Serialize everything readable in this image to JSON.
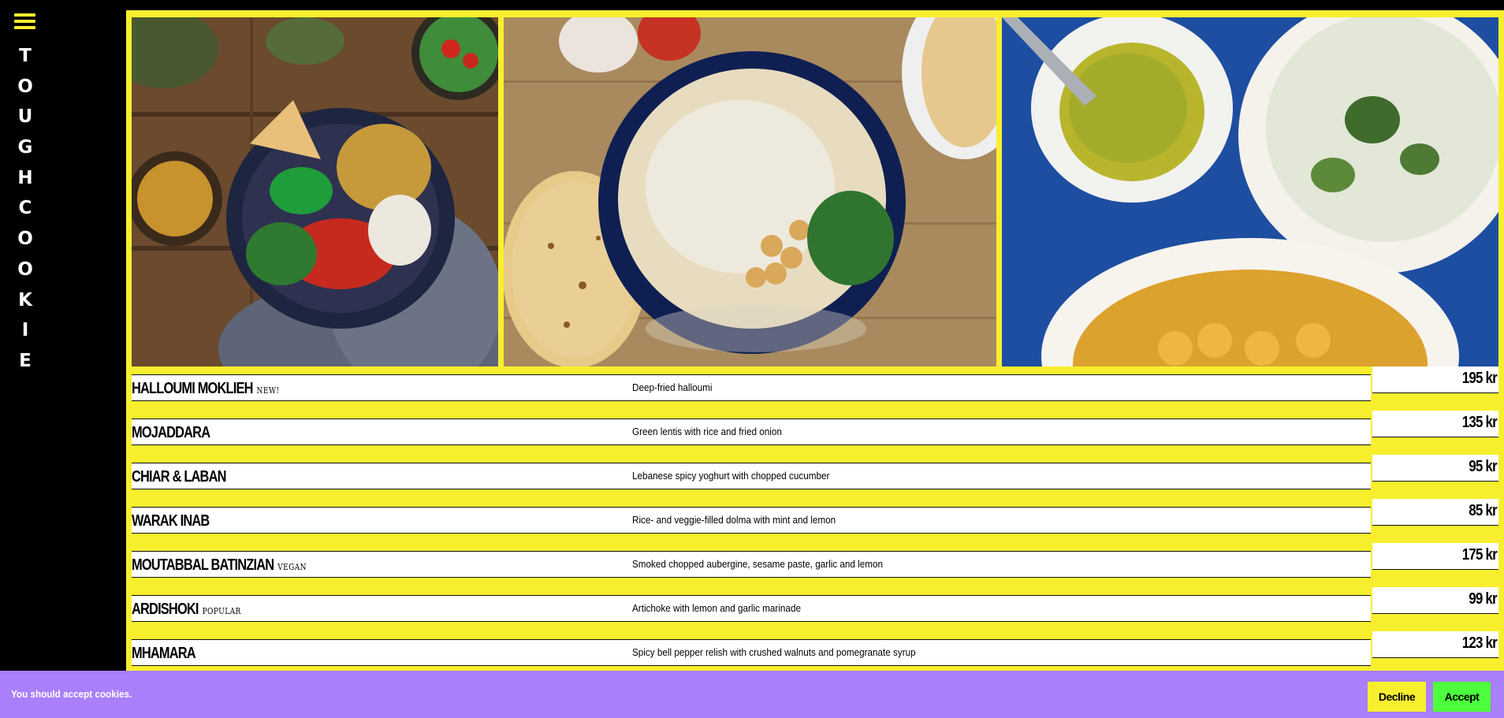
{
  "sidebar": {
    "menu_icon": "hamburger-menu-icon",
    "logo_letters": [
      "T",
      "O",
      "U",
      "G",
      "H",
      "C",
      "O",
      "O",
      "K",
      "I",
      "E"
    ]
  },
  "colors": {
    "accent_yellow": "#f7ef2e",
    "cookie_bar_purple": "#a97ffb",
    "accept_green": "#4dff3c",
    "sidebar_black": "#000000"
  },
  "menu": {
    "items": [
      {
        "name": "HALLOUMI MOKLIEH",
        "tag": "NEW!",
        "description": "Deep-fried halloumi",
        "price": "195 kr"
      },
      {
        "name": "MOJADDARA",
        "tag": "",
        "description": "Green lentis with rice and fried onion",
        "price": "135 kr"
      },
      {
        "name": "CHIAR & LABAN",
        "tag": "",
        "description": "Lebanese spicy yoghurt with chopped cucumber",
        "price": "95 kr"
      },
      {
        "name": "WARAK INAB",
        "tag": "",
        "description": "Rice- and veggie-filled dolma with mint and lemon",
        "price": "85 kr"
      },
      {
        "name": "MOUTABBAL BATINZIAN",
        "tag": "VEGAN",
        "description": "Smoked chopped aubergine, sesame paste, garlic and lemon",
        "price": "175 kr"
      },
      {
        "name": "ARDISHOKI",
        "tag": "POPULAR",
        "description": "Artichoke with lemon and garlic marinade",
        "price": "99 kr"
      },
      {
        "name": "MHAMARA",
        "tag": "",
        "description": "Spicy bell pepper relish with crushed walnuts and pomegranate syrup",
        "price": "123 kr"
      }
    ]
  },
  "cookie_banner": {
    "message": "You should accept cookies.",
    "decline_label": "Decline",
    "accept_label": "Accept"
  }
}
